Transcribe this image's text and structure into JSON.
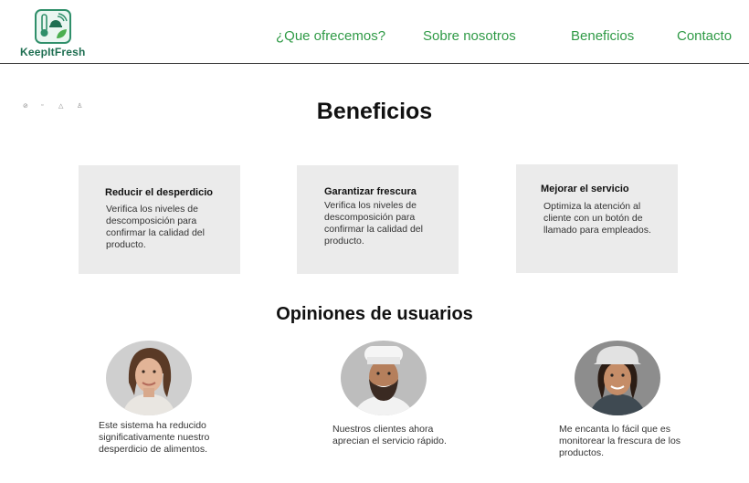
{
  "brand": {
    "name": "KeepItFresh"
  },
  "nav": {
    "items": [
      "¿Que ofrecemos?",
      "Sobre nosotros",
      "Beneficios",
      "Contacto"
    ]
  },
  "colors": {
    "accent": "#2f9a46",
    "brand": "#1f6f52",
    "card_bg": "#ebebeb"
  },
  "benefits": {
    "title": "Beneficios",
    "cards": [
      {
        "title": "Reducir el desperdicio",
        "body": "Verifica los niveles de descomposición para confirmar la calidad del producto."
      },
      {
        "title": "Garantizar frescura",
        "body": "Verifica los niveles de descomposición para confirmar la calidad del producto."
      },
      {
        "title": "Mejorar el servicio",
        "body": "Optimiza la atención al cliente con un botón de llamado para empleados."
      }
    ]
  },
  "reviews": {
    "title": "Opiniones de usuarios",
    "items": [
      {
        "avatar": "woman-portrait",
        "text": "Este sistema ha reducido significativamente nuestro desperdicio de alimentos."
      },
      {
        "avatar": "chef-portrait",
        "text": "Nuestros clientes ahora aprecian el servicio rápido."
      },
      {
        "avatar": "worker-helmet-portrait",
        "text": "Me encanta lo fácil que es monitorear la frescura de los productos."
      }
    ]
  }
}
